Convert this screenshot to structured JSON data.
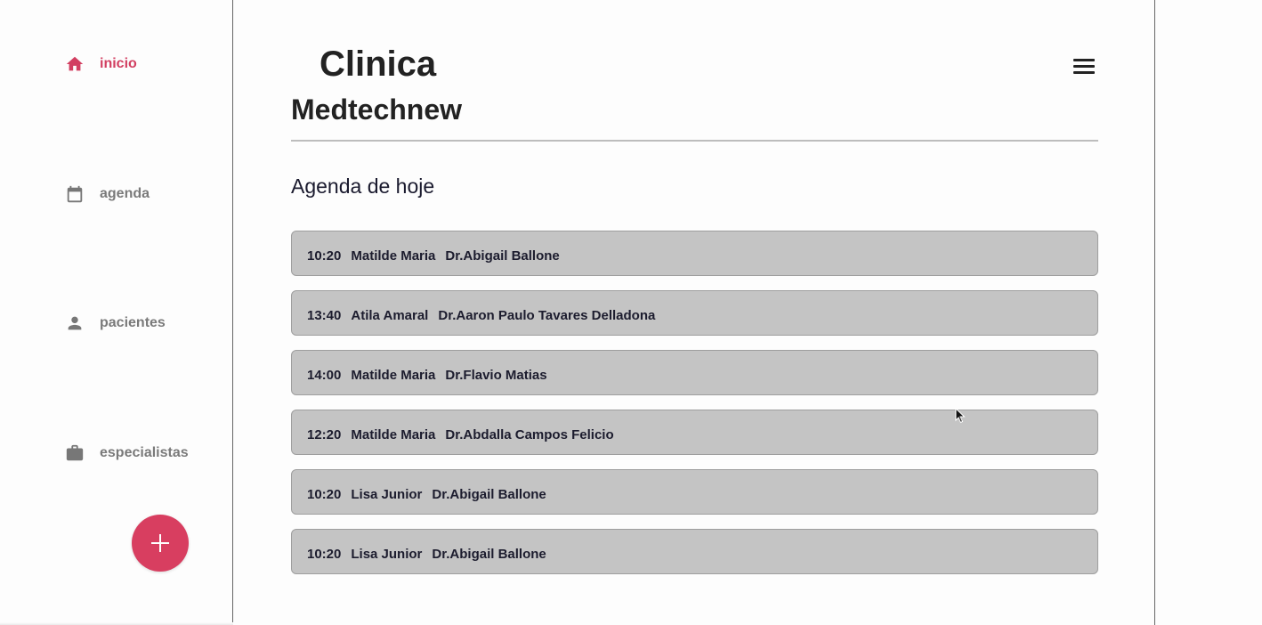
{
  "sidebar": {
    "items": [
      {
        "label": "inicio",
        "icon": "home-icon",
        "active": true
      },
      {
        "label": "agenda",
        "icon": "calendar-icon",
        "active": false
      },
      {
        "label": "pacientes",
        "icon": "person-icon",
        "active": false
      },
      {
        "label": "especialistas",
        "icon": "briefcase-icon",
        "active": false
      }
    ],
    "fab_icon": "plus-icon"
  },
  "header": {
    "title_line1": "Clinica",
    "title_line2": "Medtechnew",
    "menu_icon": "hamburger-menu-icon"
  },
  "agenda": {
    "section_title": "Agenda de hoje",
    "appointments": [
      {
        "time": "10:20",
        "patient": "Matilde Maria",
        "doctor": "Dr.Abigail Ballone"
      },
      {
        "time": "13:40",
        "patient": "Atila Amaral",
        "doctor": "Dr.Aaron Paulo Tavares Delladona"
      },
      {
        "time": "14:00",
        "patient": "Matilde Maria",
        "doctor": "Dr.Flavio Matias"
      },
      {
        "time": "12:20",
        "patient": "Matilde Maria",
        "doctor": "Dr.Abdalla Campos Felicio"
      },
      {
        "time": "10:20",
        "patient": "Lisa Junior",
        "doctor": "Dr.Abigail Ballone"
      },
      {
        "time": "10:20",
        "patient": "Lisa Junior",
        "doctor": "Dr.Abigail Ballone"
      }
    ]
  },
  "colors": {
    "accent": "#d83e60",
    "card_bg": "#c4c4c4",
    "nav_inactive": "#7a7a7a"
  }
}
